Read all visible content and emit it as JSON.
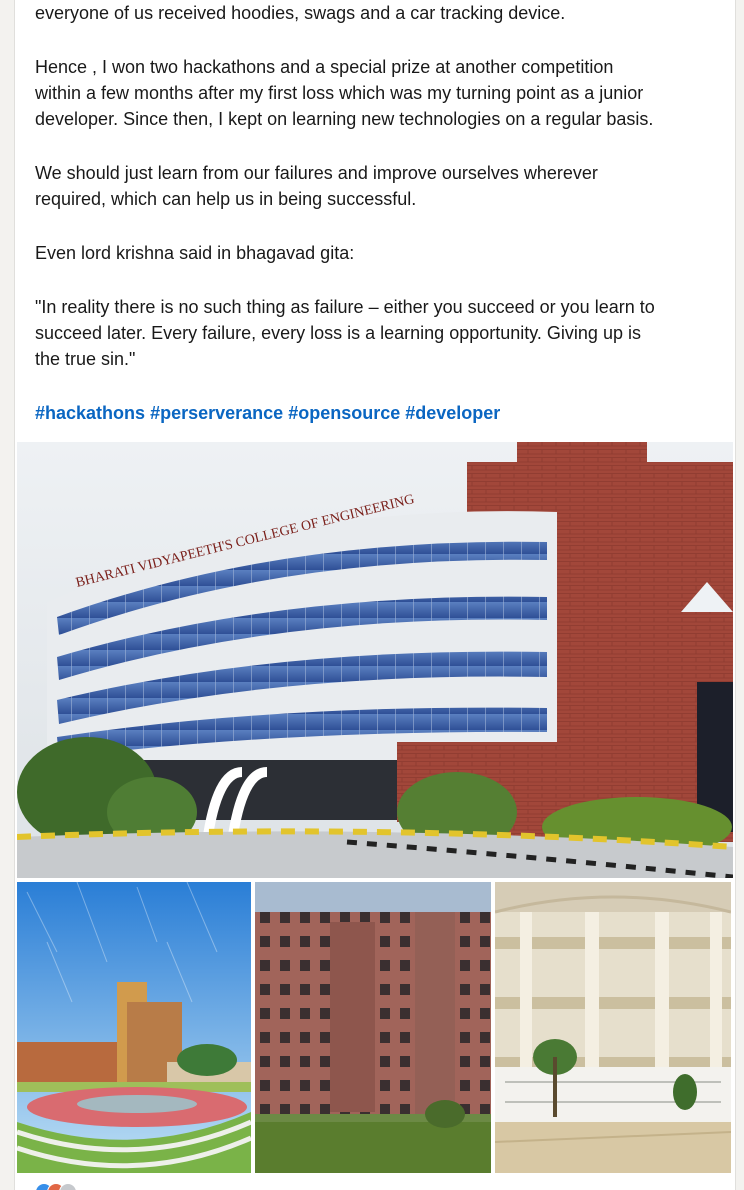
{
  "post": {
    "paragraphs": [
      {
        "lines": [
          "everyone of us received hoodies, swags and a car tracking device."
        ]
      },
      {
        "lines": [
          "Hence , I won two hackathons and a special prize at another competition",
          "within a few months after my first loss which was my turning point as a junior",
          "developer. Since then, I kept on learning new technologies on a regular basis."
        ]
      },
      {
        "lines": [
          "We should just learn from our failures and improve ourselves wherever",
          "required, which can help us in being successful."
        ]
      },
      {
        "lines": [
          "Even lord krishna said in bhagavad gita:"
        ]
      },
      {
        "lines": [
          "\"In reality there is no such thing as failure – either you succeed or you learn to",
          "succeed later. Every failure, every loss is a learning opportunity. Giving up is",
          "the true sin.\""
        ]
      }
    ],
    "hashtags": [
      "#hackathons",
      "#perserverance",
      "#opensource",
      "#developer"
    ],
    "photos": {
      "main": {
        "sign_text": "BHARATI VIDYAPEETH'S COLLEGE OF ENGINEERING"
      }
    }
  },
  "colors": {
    "link": "#0a66c2",
    "text": "#191919",
    "reaction_like": "#378fe9",
    "reaction_celebrate": "#e16745",
    "reaction_support": "#c6c9cd"
  }
}
